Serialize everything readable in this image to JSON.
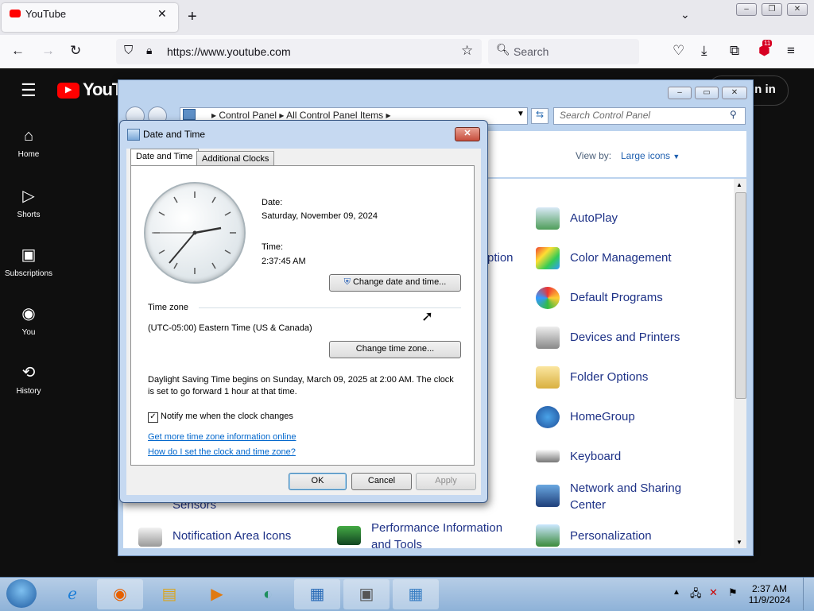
{
  "browser": {
    "tab_title": "YouTube",
    "url": "https://www.youtube.com",
    "search_placeholder": "Search",
    "extension_badge": "11"
  },
  "youtube": {
    "logo_text": "YouTu",
    "signin_label": "gn in",
    "sidebar": [
      {
        "label": "Home",
        "icon": "home-icon"
      },
      {
        "label": "Shorts",
        "icon": "shorts-icon"
      },
      {
        "label": "Subscriptions",
        "icon": "subscriptions-icon"
      },
      {
        "label": "You",
        "icon": "you-icon"
      },
      {
        "label": "History",
        "icon": "history-icon"
      }
    ]
  },
  "control_panel": {
    "breadcrumb": [
      "Control Panel",
      "All Control Panel Items"
    ],
    "search_placeholder": "Search Control Panel",
    "view_by_label": "View by:",
    "view_by_value": "Large icons",
    "items_col3": [
      "AutoPlay",
      "Color Management",
      "Default Programs",
      "Devices and Printers",
      "Folder Options",
      "HomeGroup",
      "Keyboard",
      "Network and Sharing Center",
      "Personalization"
    ],
    "partial_items": {
      "description_fragment": "ption",
      "sensors": "Sensors",
      "notification": "Notification Area Icons",
      "performance": "Performance Information and Tools"
    }
  },
  "dialog": {
    "title": "Date and Time",
    "tabs": [
      "Date and Time",
      "Additional Clocks"
    ],
    "date_label": "Date:",
    "date_value": "Saturday, November 09, 2024",
    "time_label": "Time:",
    "time_value": "2:37:45 AM",
    "change_datetime_button": "Change date and time...",
    "timezone_label": "Time zone",
    "timezone_value": "(UTC-05:00) Eastern Time (US & Canada)",
    "change_timezone_button": "Change time zone...",
    "dst_text": "Daylight Saving Time begins on Sunday, March 09, 2025 at 2:00 AM. The clock is set to go forward 1 hour at that time.",
    "notify_label": "Notify me when the clock changes",
    "notify_checked": true,
    "link1": "Get more time zone information online",
    "link2": "How do I set the clock and time zone?",
    "ok_button": "OK",
    "cancel_button": "Cancel",
    "apply_button": "Apply"
  },
  "taskbar": {
    "time": "2:37 AM",
    "date": "11/9/2024"
  }
}
